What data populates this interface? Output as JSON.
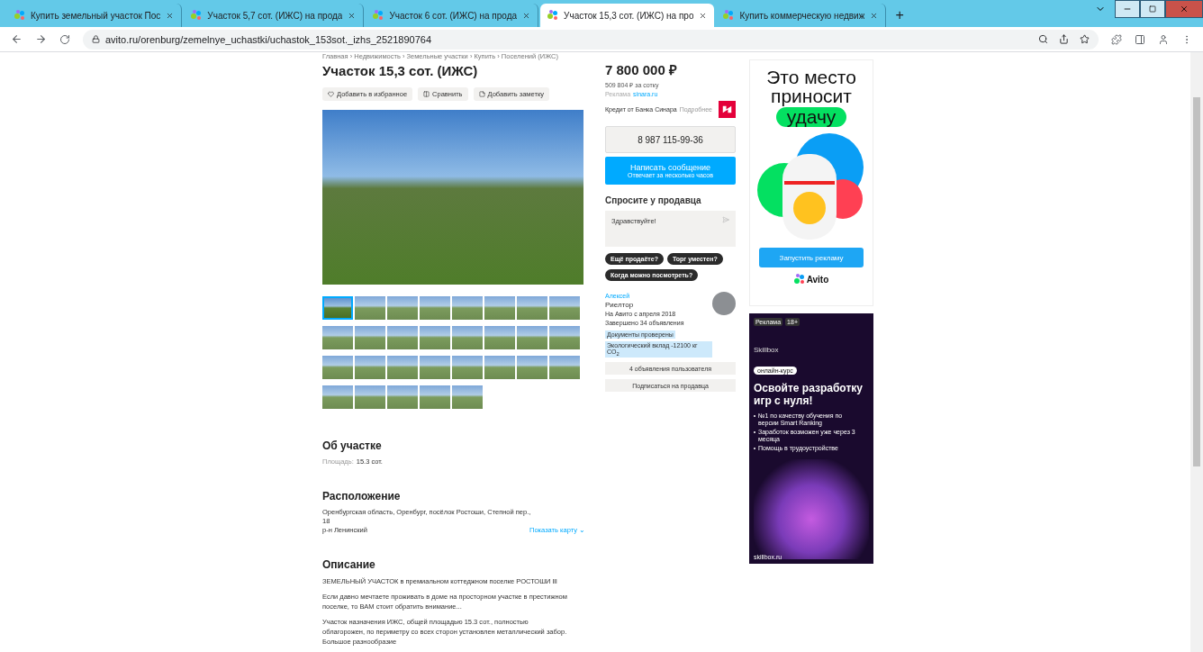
{
  "browser": {
    "tabs": [
      {
        "title": "Купить земельный участок Пос",
        "selected": false
      },
      {
        "title": "Участок 5,7 сот. (ИЖС) на прода",
        "selected": false
      },
      {
        "title": "Участок 6 сот. (ИЖС) на прода",
        "selected": false
      },
      {
        "title": "Участок 15,3 сот. (ИЖС) на про",
        "selected": true
      },
      {
        "title": "Купить коммерческую недвиж",
        "selected": false
      }
    ],
    "new_tab": "+",
    "url": "avito.ru/orenburg/zemelnye_uchastki/uchastok_153sot._izhs_2521890764"
  },
  "listing": {
    "breadcrumb": "Главная › Недвижимость › Земельные участки › Купить › Поселений (ИЖС)",
    "title": "Участок 15,3 сот. (ИЖС)",
    "actions": [
      {
        "label": "Добавить в избранное",
        "kind": "heart"
      },
      {
        "label": "Сравнить",
        "kind": "compare"
      },
      {
        "label": "Добавить заметку",
        "kind": "note"
      }
    ],
    "thumbnails": [
      {
        "selected": true
      },
      {
        "selected": false
      },
      {
        "selected": false
      },
      {
        "selected": false
      },
      {
        "selected": false
      },
      {
        "selected": false
      },
      {
        "selected": false
      },
      {
        "selected": false
      },
      {
        "selected": false
      },
      {
        "selected": false
      },
      {
        "selected": false
      },
      {
        "selected": false
      },
      {
        "selected": false
      },
      {
        "selected": false
      },
      {
        "selected": false
      },
      {
        "selected": false
      },
      {
        "selected": false
      },
      {
        "selected": false
      },
      {
        "selected": false
      },
      {
        "selected": false
      },
      {
        "selected": false
      },
      {
        "selected": false
      },
      {
        "selected": false
      },
      {
        "selected": false
      },
      {
        "selected": false
      },
      {
        "selected": false
      },
      {
        "selected": false
      },
      {
        "selected": false
      },
      {
        "selected": false
      }
    ],
    "about": {
      "heading": "Об участке",
      "label": "Площадь:",
      "value": "15.3 сот."
    },
    "location": {
      "heading": "Расположение",
      "address": "Оренбургская область, Оренбург, посёлок Ростоши, Степной пер.,",
      "house": "18",
      "district": "р-н Ленинский",
      "map_link": "Показать карту ⌄"
    },
    "description": {
      "heading": "Описание",
      "paragraphs": [
        "ЗЕМЕЛЬНЫЙ УЧАСТОК в премиальном коттеджном поселке РОСТОШИ lll",
        "Если давно мечтаете проживать в доме на просторном участке в престижном поселке, то ВАМ стоит обратить внимание...",
        "Участок назначения ИЖС, общей площадью 15.3 сот., полностью облагорожен, по периметру со всех сторон установлен металлический забор. Большое разнообразие"
      ]
    }
  },
  "sidebar": {
    "price": "7 800 000 ₽",
    "per_unit": "509 804 ₽ за сотку",
    "ad_label": "Реклама",
    "ad_link": "sinara.ru",
    "credit": "Кредит от Банка Синара",
    "credit_more": "Подробнее",
    "phone": "8 987 115-99-36",
    "message_button": "Написать сообщение",
    "message_note": "Отвечает за несколько часов",
    "ask_heading": "Спросите у продавца",
    "ask_value": "Здравствуйте!",
    "quick_questions": [
      "Ещё продаёте?",
      "Торг уместен?",
      "Когда можно посмотреть?"
    ],
    "seller": {
      "name": "Алексей",
      "type": "Риелтор",
      "since": "На Авито с апреля 2018",
      "completed": "Завершено 34 объявления",
      "badges": [
        "Документы проверены",
        "Экологический вклад -12100 кг CO$_{2}$"
      ]
    },
    "seller_buttons": [
      "4 объявления пользователя",
      "Подписаться на продавца"
    ]
  },
  "ads": [
    {
      "kind": "avito",
      "headline": "Это место приносит",
      "highlight": "удачу",
      "button": "Запустить рекламу",
      "logo": "Avito"
    },
    {
      "kind": "skillbox",
      "label": "Реклама",
      "age": "18+",
      "brand": "Skillbox",
      "tag": "онлайн-курс",
      "headline": "Освойте разработку игр с нуля!",
      "bullets": [
        "№1 по качеству обучения по версии Smart Ranking",
        "Заработок возможен уже через 3 месяца",
        "Помощь в трудоустройстве"
      ],
      "site": "skillbox.ru"
    }
  ]
}
